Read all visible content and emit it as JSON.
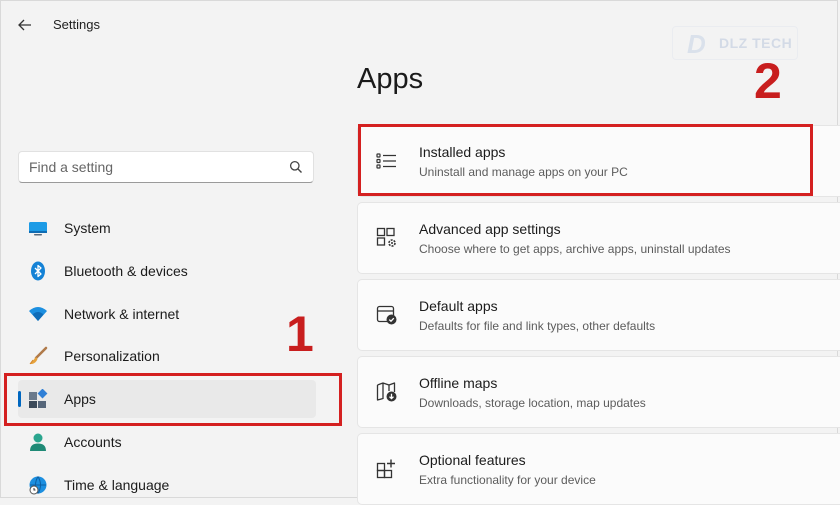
{
  "window": {
    "title": "Settings"
  },
  "watermark": {
    "mark": "D",
    "text": "DLZ TECH"
  },
  "search": {
    "placeholder": "Find a setting",
    "value": ""
  },
  "sidebar": {
    "items": [
      {
        "label": "System",
        "icon": "system-monitor-icon"
      },
      {
        "label": "Bluetooth & devices",
        "icon": "bluetooth-icon"
      },
      {
        "label": "Network & internet",
        "icon": "wifi-icon"
      },
      {
        "label": "Personalization",
        "icon": "paintbrush-icon"
      },
      {
        "label": "Apps",
        "icon": "apps-icon",
        "selected": true
      },
      {
        "label": "Accounts",
        "icon": "person-icon"
      },
      {
        "label": "Time & language",
        "icon": "globe-clock-icon"
      }
    ]
  },
  "page": {
    "heading": "Apps",
    "cards": [
      {
        "title": "Installed apps",
        "subtitle": "Uninstall and manage apps on your PC",
        "icon": "list-icon"
      },
      {
        "title": "Advanced app settings",
        "subtitle": "Choose where to get apps, archive apps, uninstall updates",
        "icon": "apps-gear-icon"
      },
      {
        "title": "Default apps",
        "subtitle": "Defaults for file and link types, other defaults",
        "icon": "default-apps-icon"
      },
      {
        "title": "Offline maps",
        "subtitle": "Downloads, storage location, map updates",
        "icon": "map-download-icon"
      },
      {
        "title": "Optional features",
        "subtitle": "Extra functionality for your device",
        "icon": "add-grid-icon"
      }
    ]
  },
  "annotations": {
    "step1": "1",
    "step2": "2"
  },
  "colors": {
    "accent": "#0067c0",
    "annotation_red": "#d42020",
    "background": "#f3f3f3"
  }
}
